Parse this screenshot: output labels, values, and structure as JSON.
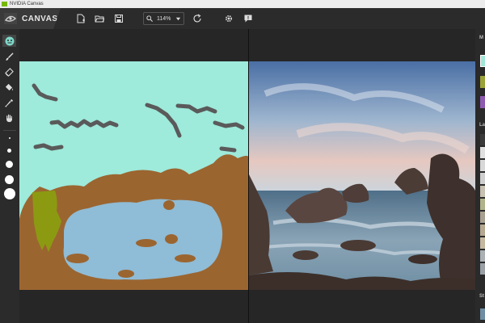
{
  "window": {
    "title": "NVIDIA Canvas"
  },
  "app": {
    "name": "CANVAS"
  },
  "toolbar": {
    "zoom_value": "114%",
    "buttons": [
      "new-file",
      "open-file",
      "save-file",
      "zoom",
      "reset",
      "settings",
      "feedback"
    ]
  },
  "left_tools": [
    {
      "name": "style-tool",
      "icon": "palette-icon",
      "active": true
    },
    {
      "name": "brush-tool",
      "icon": "brush-icon"
    },
    {
      "name": "eraser-tool",
      "icon": "eraser-icon"
    },
    {
      "name": "fill-tool",
      "icon": "paint-bucket-icon"
    },
    {
      "name": "eyedropper-tool",
      "icon": "eyedropper-icon"
    },
    {
      "name": "pan-tool",
      "icon": "hand-icon"
    }
  ],
  "brush_sizes": [
    "xs",
    "sm",
    "md",
    "lg",
    "xl"
  ],
  "right_panel": {
    "sections": [
      "M",
      "La",
      "St"
    ],
    "material_swatches": [
      "#9fe8d8",
      "#9aa23a",
      "#8e5ab0"
    ],
    "layer_colors": [
      "#3a3a3a",
      "#e0e0e0",
      "#d8d8d8",
      "#cfcfcf",
      "#c8c0b0",
      "#b0b28a",
      "#a8a090",
      "#b4a890"
    ]
  },
  "colors": {
    "sky": "#9eeadb",
    "water": "#8fbcd6",
    "rock": "#9b6530",
    "grass": "#8c9a12",
    "cloud": "#5a5a5a",
    "accent": "#76b900"
  }
}
